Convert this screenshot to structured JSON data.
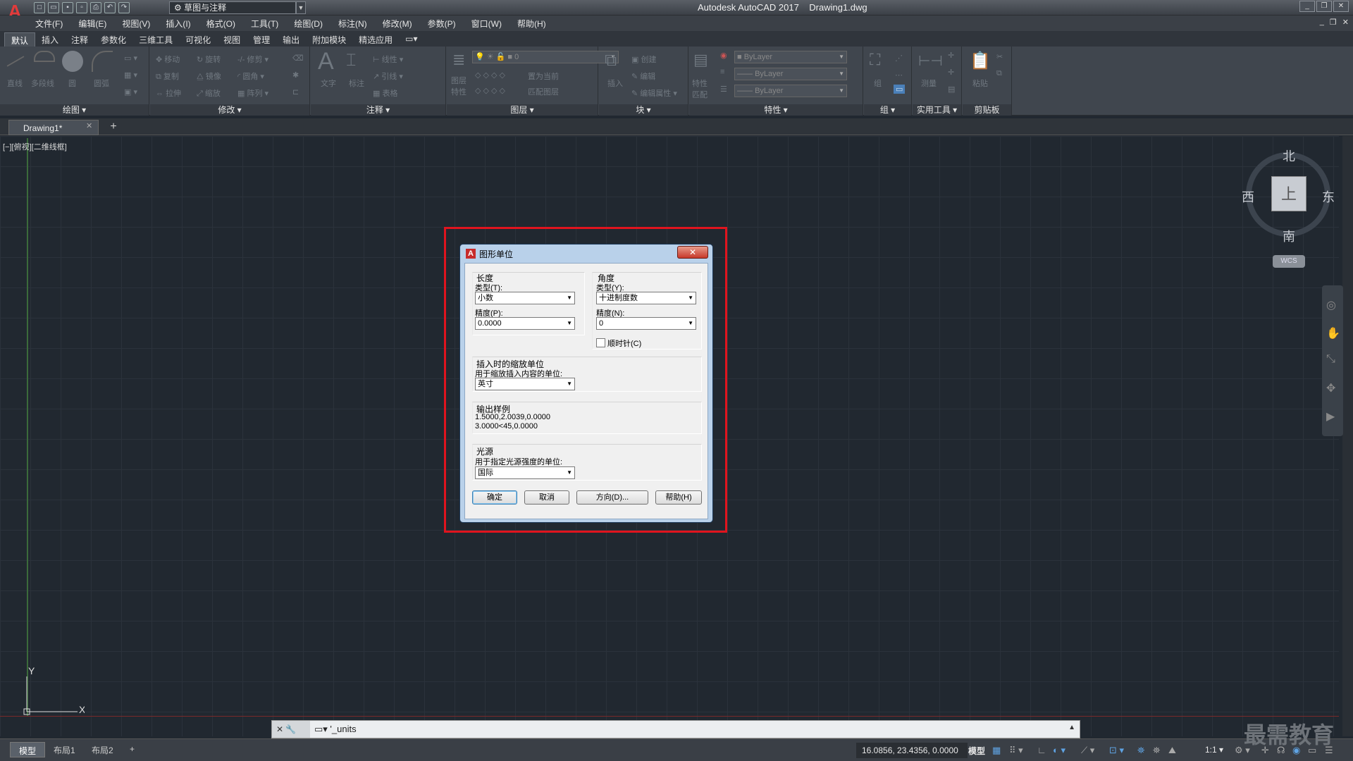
{
  "app": {
    "title": "Autodesk AutoCAD 2017    Drawing1.dwg",
    "logo_letter": "A",
    "workspace": "草图与注释"
  },
  "menubar": [
    "文件(F)",
    "编辑(E)",
    "视图(V)",
    "插入(I)",
    "格式(O)",
    "工具(T)",
    "绘图(D)",
    "标注(N)",
    "修改(M)",
    "参数(P)",
    "窗口(W)",
    "帮助(H)"
  ],
  "ribbon_tabs": [
    "默认",
    "插入",
    "注释",
    "参数化",
    "三维工具",
    "可视化",
    "视图",
    "管理",
    "输出",
    "附加模块",
    "精选应用"
  ],
  "ribbon": {
    "panels": [
      "绘图 ▾",
      "修改 ▾",
      "注释 ▾",
      "图层 ▾",
      "块 ▾",
      "特性 ▾",
      "组 ▾",
      "实用工具 ▾",
      "剪贴板"
    ],
    "draw_tools": [
      "直线",
      "多段线",
      "圆",
      "圆弧"
    ],
    "modify_tools": [
      "移动",
      "旋转",
      "修剪",
      "复制",
      "镜像",
      "圆角",
      "拉伸",
      "缩放",
      "阵列"
    ],
    "annotation_tools": [
      "文字",
      "标注",
      "线性",
      "引线",
      "表格"
    ],
    "layer_tools": [
      "图层特性",
      "置为当前",
      "匹配图层"
    ],
    "layer_value": "0",
    "block_tools": [
      "插入",
      "创建",
      "编辑",
      "编辑属性"
    ],
    "properties_tools": [
      "特性匹配"
    ],
    "bylayer": [
      "ByLayer",
      "ByLayer",
      "ByLayer"
    ],
    "group_tools": [
      "组"
    ],
    "utility_tools": [
      "测量"
    ],
    "clipboard_tools": [
      "粘贴"
    ]
  },
  "file_tab": {
    "name": "Drawing1*",
    "close": "✕",
    "add": "+"
  },
  "viewport_label": "[−][俯视][二维线框]",
  "viewcube": {
    "north": "北",
    "south": "南",
    "east": "东",
    "west": "西",
    "face": "上",
    "wcs": "WCS"
  },
  "ucs": {
    "y": "Y",
    "x": "X"
  },
  "dialog": {
    "title": "图形单位",
    "close": "✕",
    "length": {
      "group": "长度",
      "type_label": "类型(T):",
      "type_value": "小数",
      "precision_label": "精度(P):",
      "precision_value": "0.0000"
    },
    "angle": {
      "group": "角度",
      "type_label": "类型(Y):",
      "type_value": "十进制度数",
      "precision_label": "精度(N):",
      "precision_value": "0",
      "clockwise": "顺时针(C)",
      "clockwise_checked": false
    },
    "insert_scale": {
      "group": "插入时的缩放单位",
      "desc": "用于缩放插入内容的单位:",
      "value": "英寸"
    },
    "output_sample": {
      "group": "输出样例",
      "line1": "1.5000,2.0039,0.0000",
      "line2": "3.0000<45,0.0000"
    },
    "lighting": {
      "group": "光源",
      "desc": "用于指定光源强度的单位:",
      "value": "国际"
    },
    "buttons": {
      "ok": "确定",
      "cancel": "取消",
      "direction": "方向(D)...",
      "help": "帮助(H)"
    }
  },
  "command_line": {
    "text": "'_units",
    "close": "✕"
  },
  "status": {
    "layout_tabs": [
      "模型",
      "布局1",
      "布局2"
    ],
    "add": "+",
    "coords": "16.0856, 23.4356, 0.0000",
    "model": "模型",
    "scale": "1:1 ▾"
  },
  "watermark": "最需教育"
}
